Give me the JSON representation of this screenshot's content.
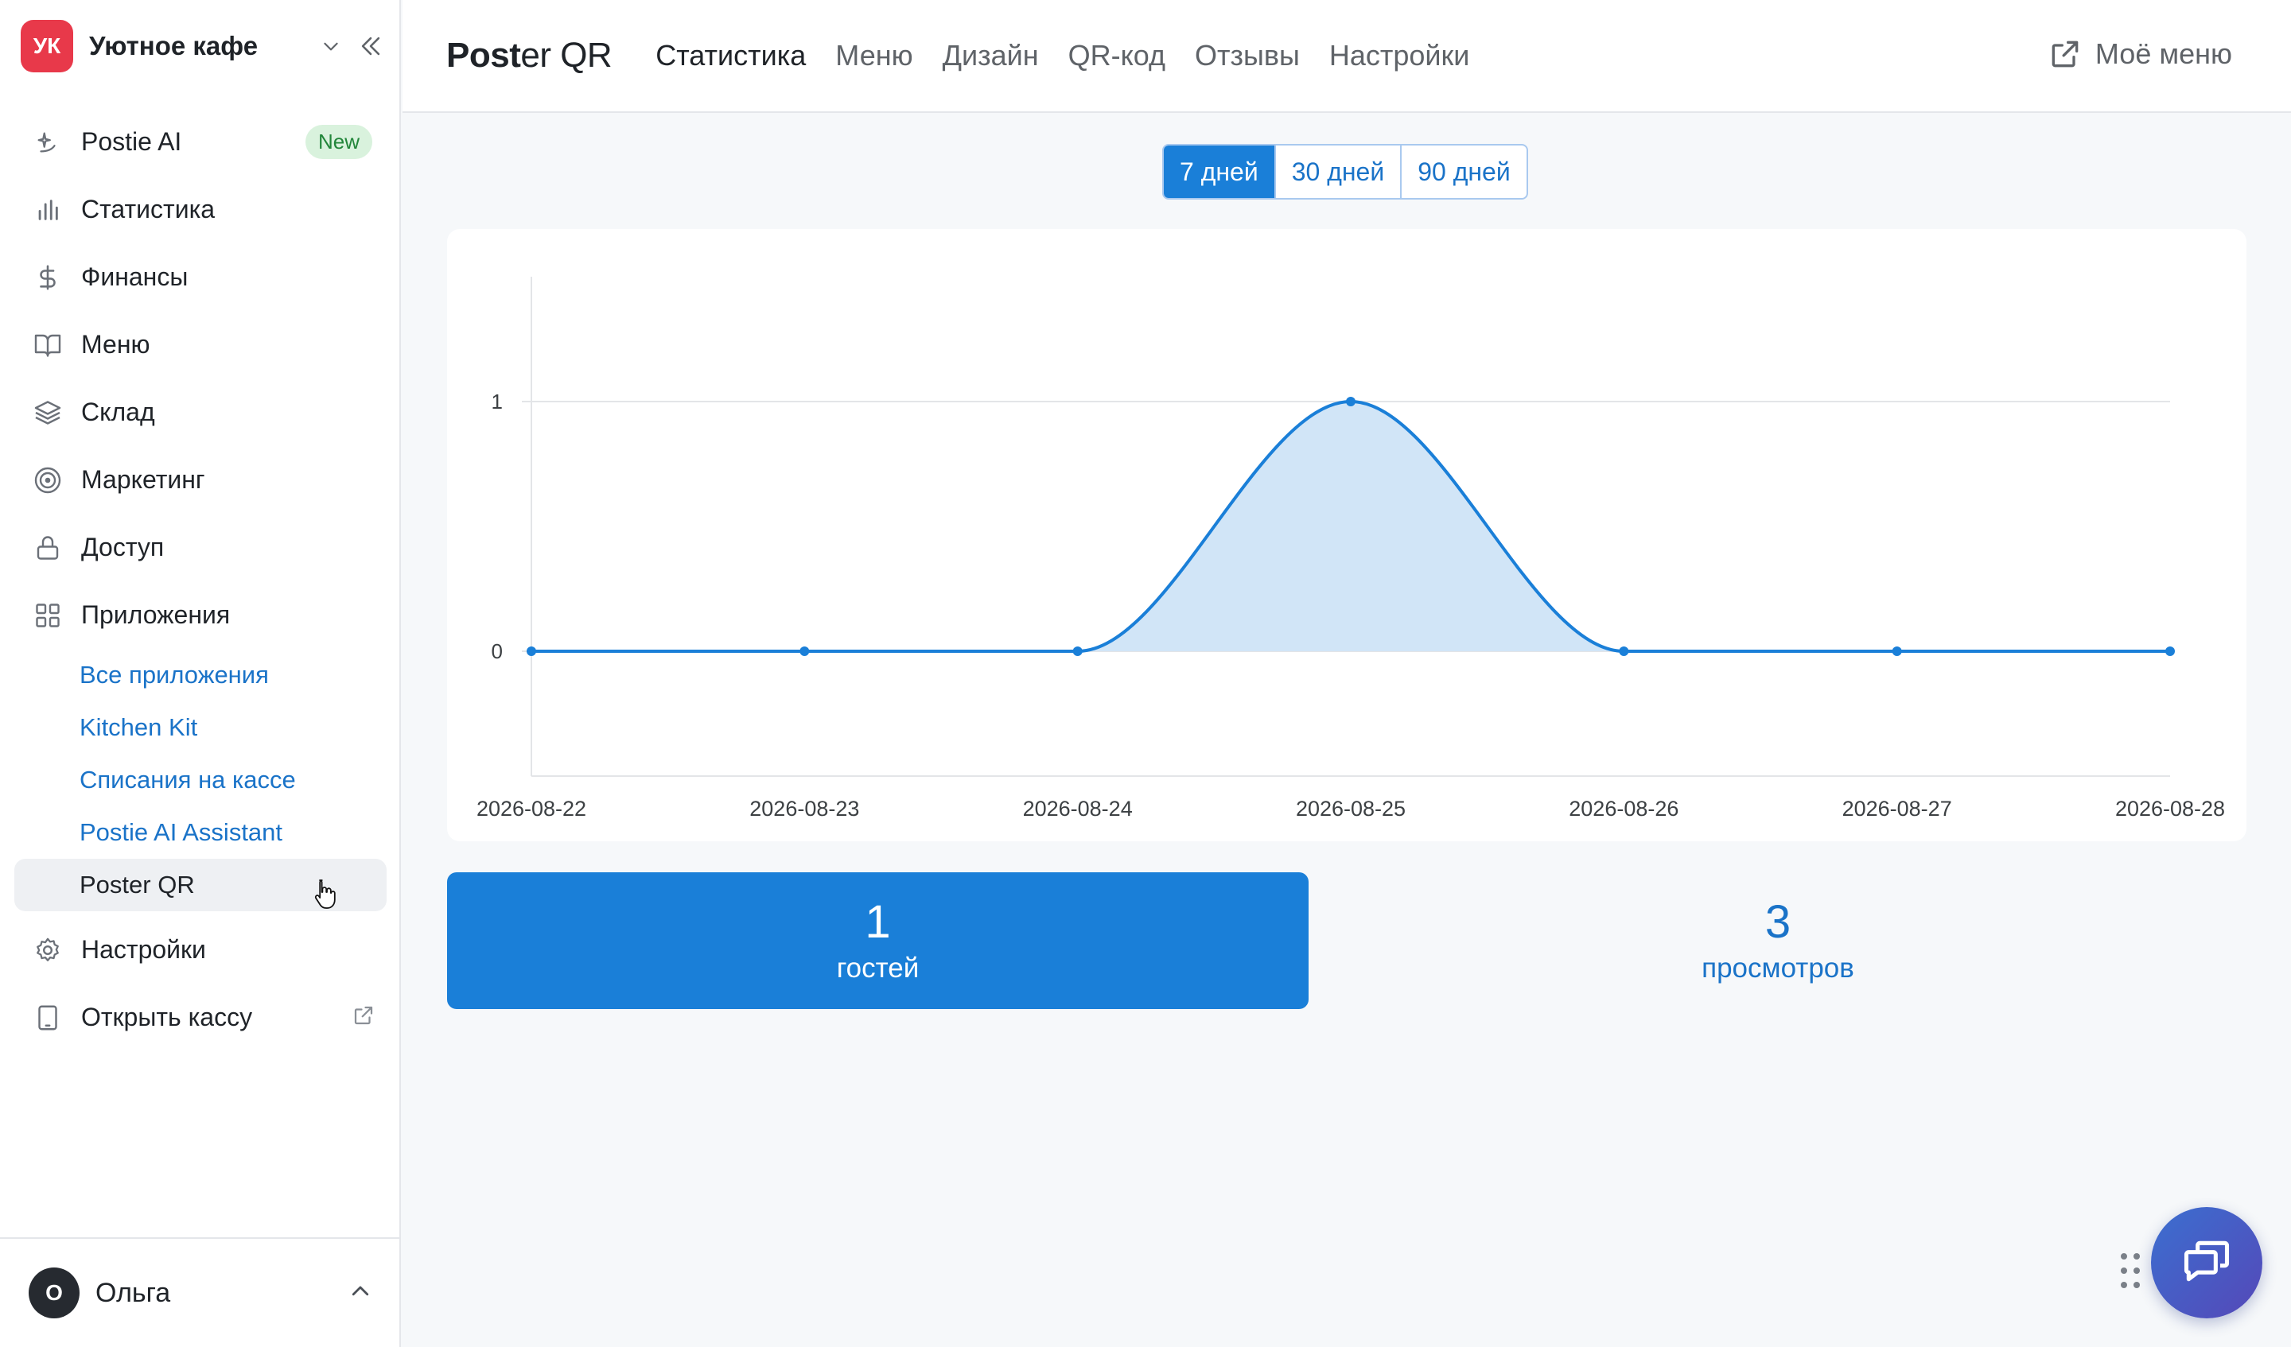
{
  "brand": {
    "initials": "УК",
    "name": "Уютное кафе",
    "color": "#e8394a"
  },
  "sidebar": {
    "items": [
      {
        "label": "Postie AI",
        "icon": "ai-sparkle-icon",
        "badge": "New"
      },
      {
        "label": "Статистика",
        "icon": "bar-chart-icon"
      },
      {
        "label": "Финансы",
        "icon": "dollar-icon"
      },
      {
        "label": "Меню",
        "icon": "book-icon"
      },
      {
        "label": "Склад",
        "icon": "layers-icon"
      },
      {
        "label": "Маркетинг",
        "icon": "target-icon"
      },
      {
        "label": "Доступ",
        "icon": "lock-icon"
      },
      {
        "label": "Приложения",
        "icon": "apps-grid-icon"
      }
    ],
    "apps": [
      "Все приложения",
      "Kitchen Kit",
      "Списания на кассе",
      "Postie AI Assistant",
      "Poster QR"
    ],
    "active_app": "Poster QR",
    "bottom_items": [
      {
        "label": "Настройки",
        "icon": "gear-icon"
      },
      {
        "label": "Открыть кассу",
        "icon": "tablet-icon"
      }
    ]
  },
  "user": {
    "initial": "О",
    "name": "Ольга"
  },
  "header": {
    "logo_bold": "Post",
    "logo_rest": "er QR",
    "tabs": [
      "Статистика",
      "Меню",
      "Дизайн",
      "QR-код",
      "Отзывы",
      "Настройки"
    ],
    "active_tab": "Статистика",
    "my_menu": "Моё меню"
  },
  "periods": {
    "options": [
      "7 дней",
      "30 дней",
      "90 дней"
    ],
    "selected": "7 дней"
  },
  "chart_data": {
    "type": "area",
    "x": [
      "2026-08-22",
      "2026-08-23",
      "2026-08-24",
      "2026-08-25",
      "2026-08-26",
      "2026-08-27",
      "2026-08-28"
    ],
    "values": [
      0,
      0,
      0,
      1,
      0,
      0,
      0
    ],
    "yticks": [
      "1",
      "0"
    ],
    "ylim": [
      -0.5,
      1.5
    ],
    "line_color": "#1a7fd8",
    "fill_color": "#d1e5f7",
    "grid": true
  },
  "stats": {
    "guests": {
      "value": "1",
      "label": "гостей"
    },
    "views": {
      "value": "3",
      "label": "просмотров"
    }
  },
  "colors": {
    "accent": "#1a7fd8",
    "link": "#1a73c8"
  }
}
